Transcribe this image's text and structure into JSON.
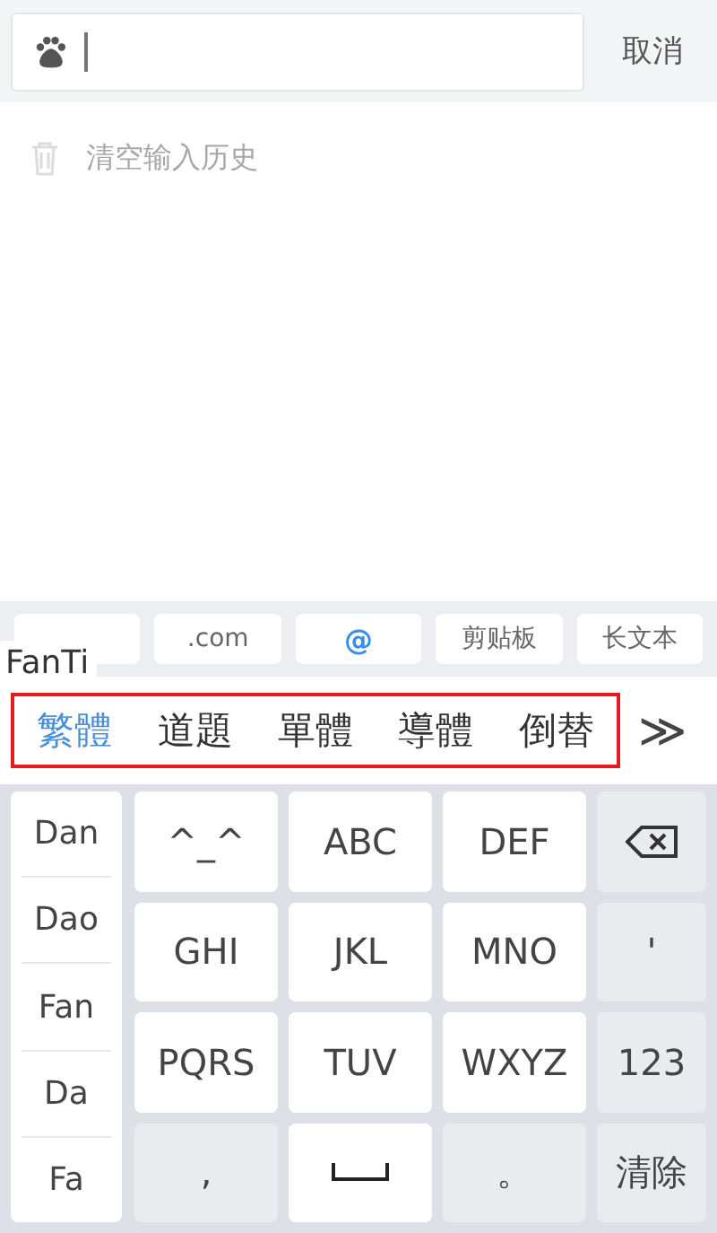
{
  "search": {
    "cancel": "取消"
  },
  "history": {
    "clear_label": "清空输入历史"
  },
  "quick_keys": [
    {
      "kind": "blank"
    },
    {
      "kind": "label",
      "label": ".com",
      "accent": false
    },
    {
      "kind": "label",
      "label": "@",
      "accent": true
    },
    {
      "kind": "label",
      "label": "剪贴板",
      "accent": false
    },
    {
      "kind": "label",
      "label": "长文本",
      "accent": false
    }
  ],
  "composition": "FanTi",
  "candidates": [
    {
      "text": "繁體",
      "selected": true
    },
    {
      "text": "道題",
      "selected": false
    },
    {
      "text": "單體",
      "selected": false
    },
    {
      "text": "導體",
      "selected": false
    },
    {
      "text": "倒替",
      "selected": false
    }
  ],
  "candidates_highlighted": true,
  "more": "≫",
  "pinyin_options": [
    "Dan",
    "Dao",
    "Fan",
    "Da",
    "Fa"
  ],
  "keys": [
    {
      "kind": "text",
      "label": "^_^",
      "shaded": false
    },
    {
      "kind": "text",
      "label": "ABC",
      "shaded": false
    },
    {
      "kind": "text",
      "label": "DEF",
      "shaded": false
    },
    {
      "kind": "backspace",
      "shaded": true
    },
    {
      "kind": "text",
      "label": "GHI",
      "shaded": false
    },
    {
      "kind": "text",
      "label": "JKL",
      "shaded": false
    },
    {
      "kind": "text",
      "label": "MNO",
      "shaded": false
    },
    {
      "kind": "text",
      "label": "'",
      "shaded": true
    },
    {
      "kind": "text",
      "label": "PQRS",
      "shaded": false
    },
    {
      "kind": "text",
      "label": "TUV",
      "shaded": false
    },
    {
      "kind": "text",
      "label": "WXYZ",
      "shaded": false
    },
    {
      "kind": "text",
      "label": "123",
      "shaded": true
    },
    {
      "kind": "text",
      "label": ",",
      "shaded": true
    },
    {
      "kind": "space",
      "shaded": false
    },
    {
      "kind": "text",
      "label": "。",
      "shaded": true
    },
    {
      "kind": "text",
      "label": "清除",
      "shaded": true
    }
  ]
}
